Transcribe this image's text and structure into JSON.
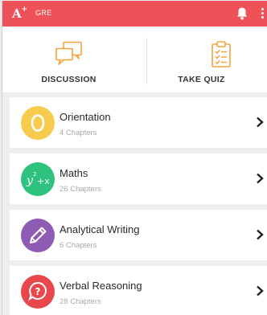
{
  "app": {
    "logo": "A",
    "logo_plus": "+",
    "subtitle": "GRE"
  },
  "actions": [
    {
      "label": "DISCUSSION",
      "icon": "discussion-icon"
    },
    {
      "label": "TAKE QUIZ",
      "icon": "quiz-clipboard-icon"
    }
  ],
  "courses": [
    {
      "title": "Orientation",
      "chapters": "4 Chapters",
      "icon": "orientation-icon",
      "color": "#f7cb4d"
    },
    {
      "title": "Maths",
      "chapters": "26 Chapters",
      "icon": "maths-icon",
      "color": "#2ec27e"
    },
    {
      "title": "Analytical Writing",
      "chapters": "6 Chapters",
      "icon": "pencil-icon",
      "color": "#8e5bb5"
    },
    {
      "title": "Verbal Reasoning",
      "chapters": "28 Chapters",
      "icon": "question-bubble-icon",
      "color": "#e8474c"
    }
  ],
  "colors": {
    "appbar": "#ee5157",
    "accent_orange": "#f4a340"
  }
}
